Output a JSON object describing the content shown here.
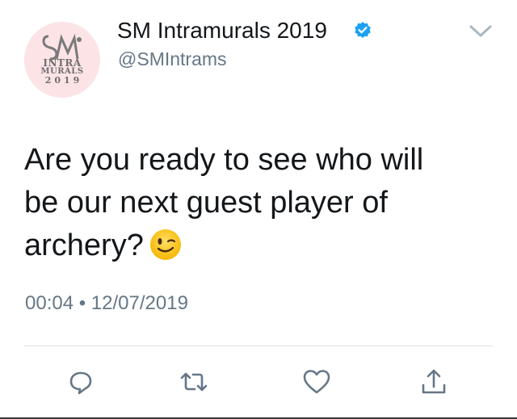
{
  "tweet": {
    "avatar": {
      "line1": "INTRA",
      "line2": "MURALS",
      "line3": "2019",
      "background": "#fbe3e6"
    },
    "display_name": "SM Intramurals 2019",
    "handle": "@SMIntrams",
    "verified": true,
    "text_line1": "Are you ready to see who will",
    "text_line2": "be our next guest player of",
    "text_line3": "archery?",
    "emoji": "winking-face",
    "timestamp": "00:04 • 12/07/2019",
    "actions": [
      "reply-icon",
      "retweet-icon",
      "like-icon",
      "share-icon"
    ]
  },
  "colors": {
    "verified": "#1da1f2",
    "secondary_text": "#657786",
    "icon": "#657786",
    "divider": "#d8dde1"
  }
}
